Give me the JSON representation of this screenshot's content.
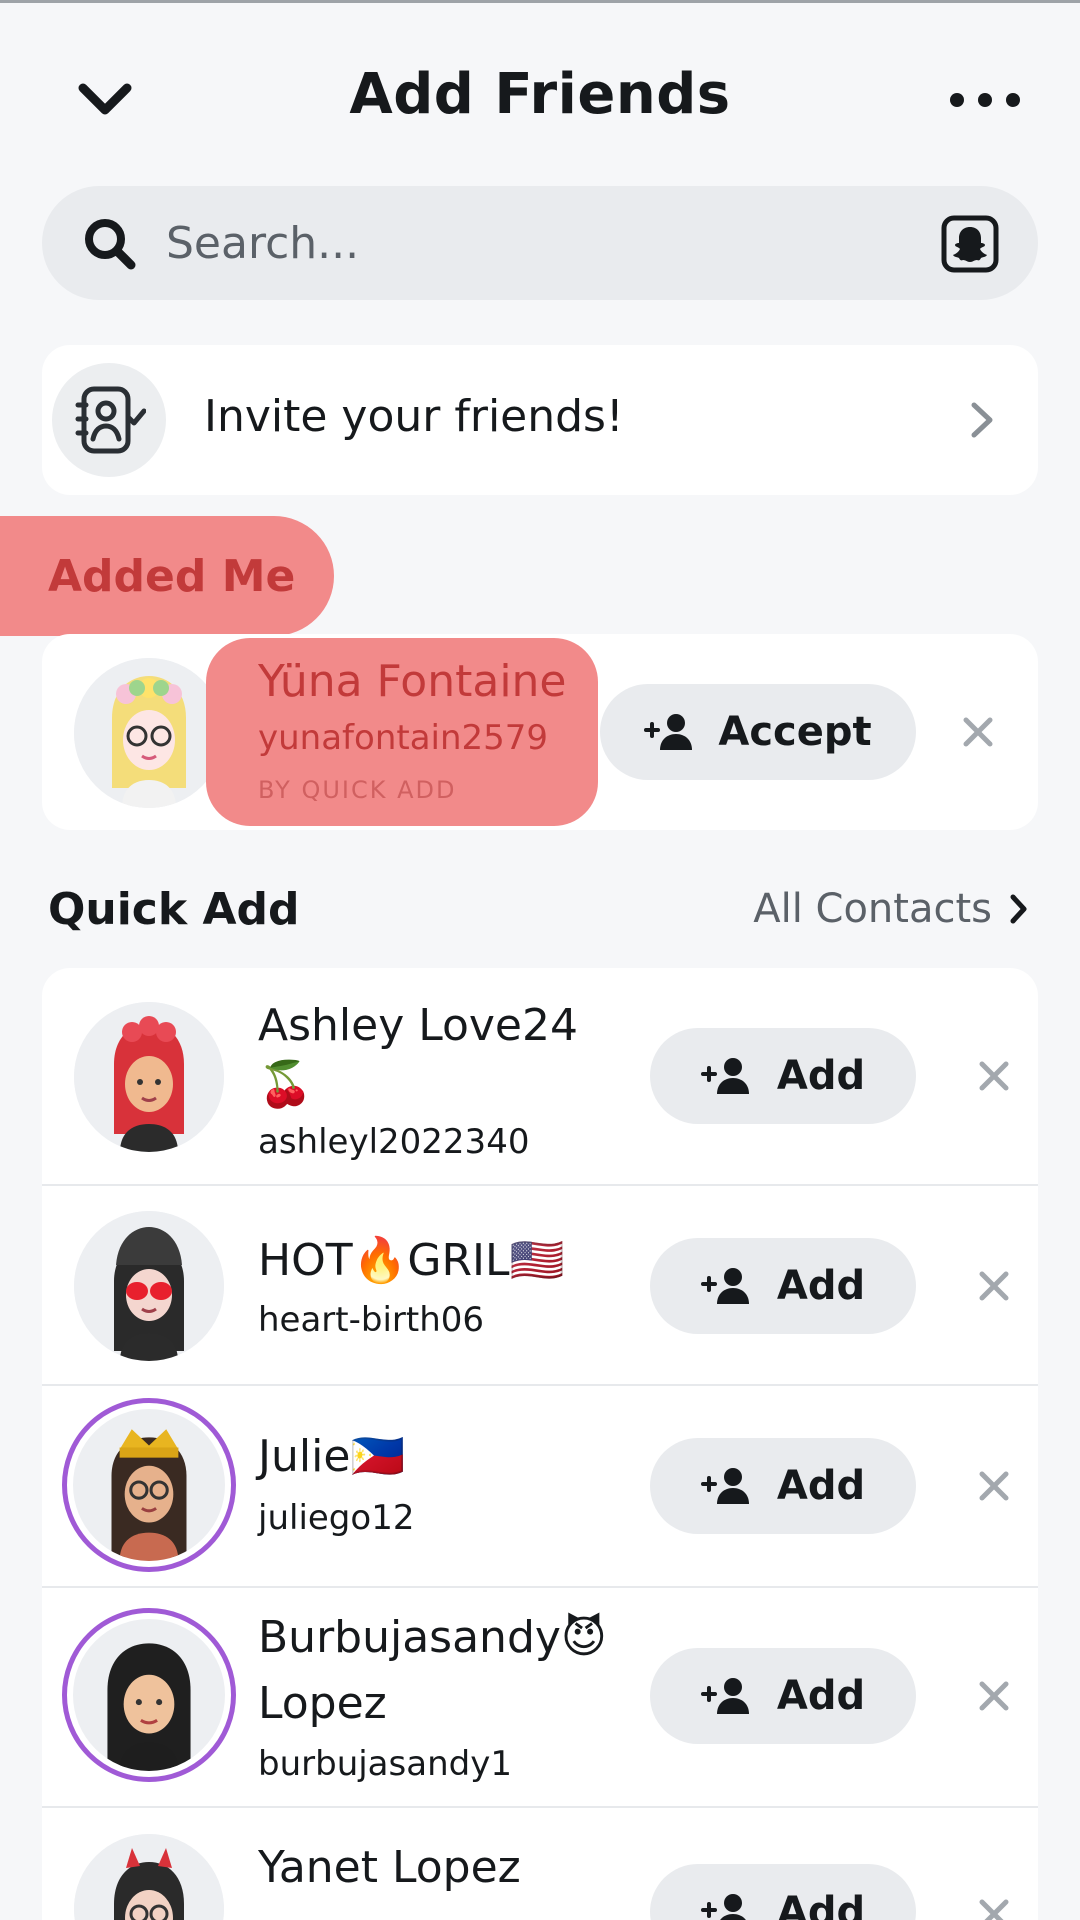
{
  "header": {
    "title": "Add Friends"
  },
  "search": {
    "placeholder": "Search..."
  },
  "invite": {
    "label": "Invite your friends!"
  },
  "added_me": {
    "section_label": "Added Me",
    "item": {
      "name": "Yüna Fontaine",
      "username": "yunafontain2579",
      "source": "BY QUICK ADD",
      "button_label": "Accept"
    }
  },
  "quick_add": {
    "section_label": "Quick Add",
    "all_contacts_label": "All Contacts",
    "items": [
      {
        "name_line1": "Ashley Love24",
        "name_line2": "🍒",
        "username": "ashleyl2022340",
        "button_label": "Add"
      },
      {
        "name_line1": "HOT🔥GRIL🇺🇸",
        "name_line2": "",
        "username": "heart-birth06",
        "button_label": "Add"
      },
      {
        "name_line1": "Julie🇵🇭",
        "name_line2": "",
        "username": "juliego12",
        "button_label": "Add"
      },
      {
        "name_line1": "Burbujasandy😈",
        "name_line2": "Lopez",
        "username": "burbujasandy1",
        "button_label": "Add"
      },
      {
        "name_line1": "Yanet Lopez",
        "name_line2": "",
        "username": "",
        "button_label": "Add"
      }
    ]
  },
  "colors": {
    "highlight": "#f28a8a",
    "highlight_text": "#c23a3a",
    "button_bg": "#e9ebee",
    "story_ring": "#a05ad6",
    "background": "#f6f7f9"
  }
}
